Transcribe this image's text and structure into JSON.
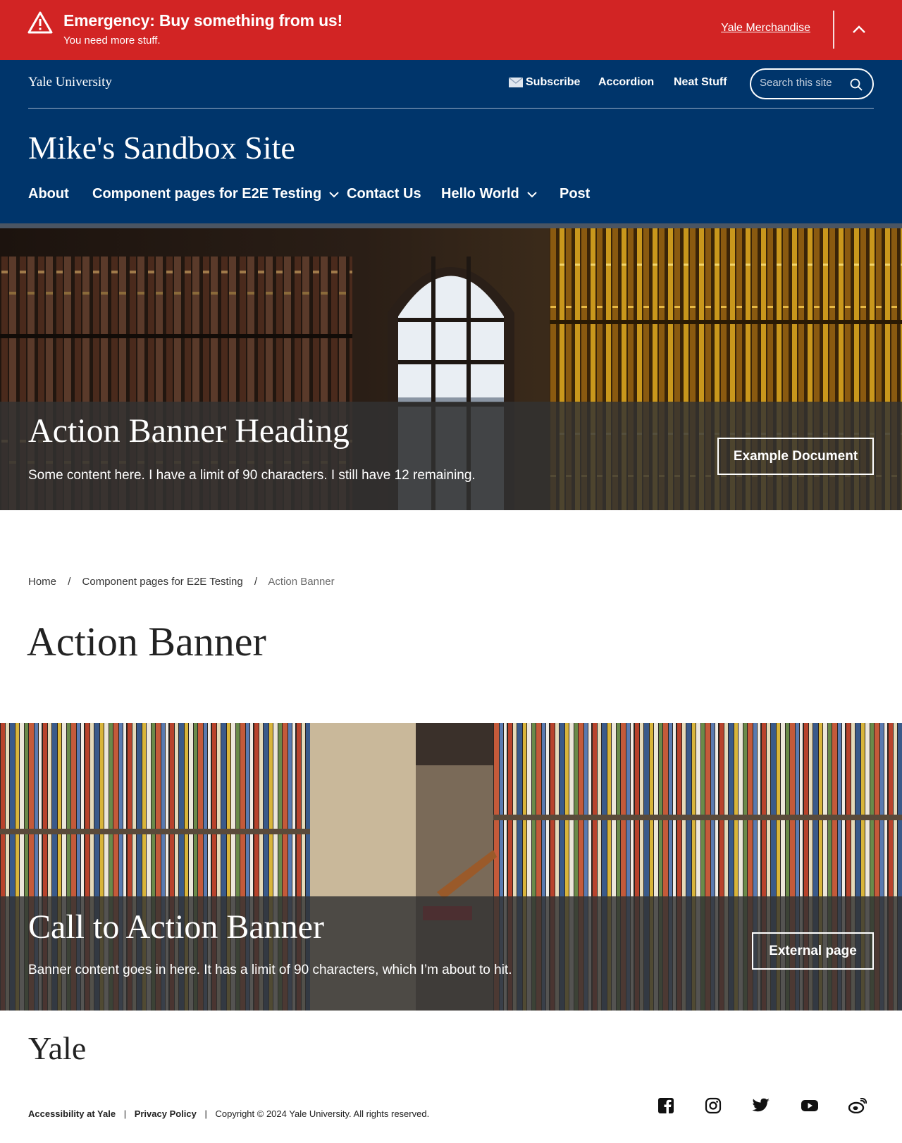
{
  "alert": {
    "heading": "Emergency: Buy something from us!",
    "text": "You need more stuff.",
    "link": "Yale Merchandise",
    "icon": "warning-triangle-icon",
    "toggle_icon": "chevron-up-icon",
    "bg_color": "#d22424"
  },
  "header": {
    "university": "Yale University",
    "utility_links": {
      "subscribe": "Subscribe",
      "accordion": "Accordion",
      "neat_stuff": "Neat Stuff"
    },
    "search": {
      "placeholder": "Search this site",
      "value": ""
    },
    "site_title": "Mike's Sandbox Site",
    "nav": {
      "about": "About",
      "component_pages": "Component pages for E2E Testing",
      "contact_us": "Contact Us",
      "hello_world": "Hello World",
      "post": "Post"
    },
    "bg_color": "#00356b"
  },
  "banner_top": {
    "heading": "Action Banner Heading",
    "text": "Some content here. I have a limit of 90 characters. I still have 12 remaining.",
    "button": "Example Document"
  },
  "breadcrumb": {
    "home": "Home",
    "sep": "/",
    "parent": "Component pages for E2E Testing",
    "current": "Action Banner"
  },
  "page_title": "Action Banner",
  "banner_bottom": {
    "heading": "Call to Action Banner",
    "text": "Banner content goes in here. It has a limit of 90 characters, which I’m about to hit.",
    "button": "External page"
  },
  "footer": {
    "logo": "Yale",
    "accessibility": "Accessibility at Yale",
    "privacy": "Privacy Policy",
    "sep": "|",
    "copyright": "Copyright © 2024 Yale University. All rights reserved.",
    "social_icons": [
      "facebook-icon",
      "instagram-icon",
      "twitter-icon",
      "youtube-icon",
      "weibo-icon"
    ]
  }
}
